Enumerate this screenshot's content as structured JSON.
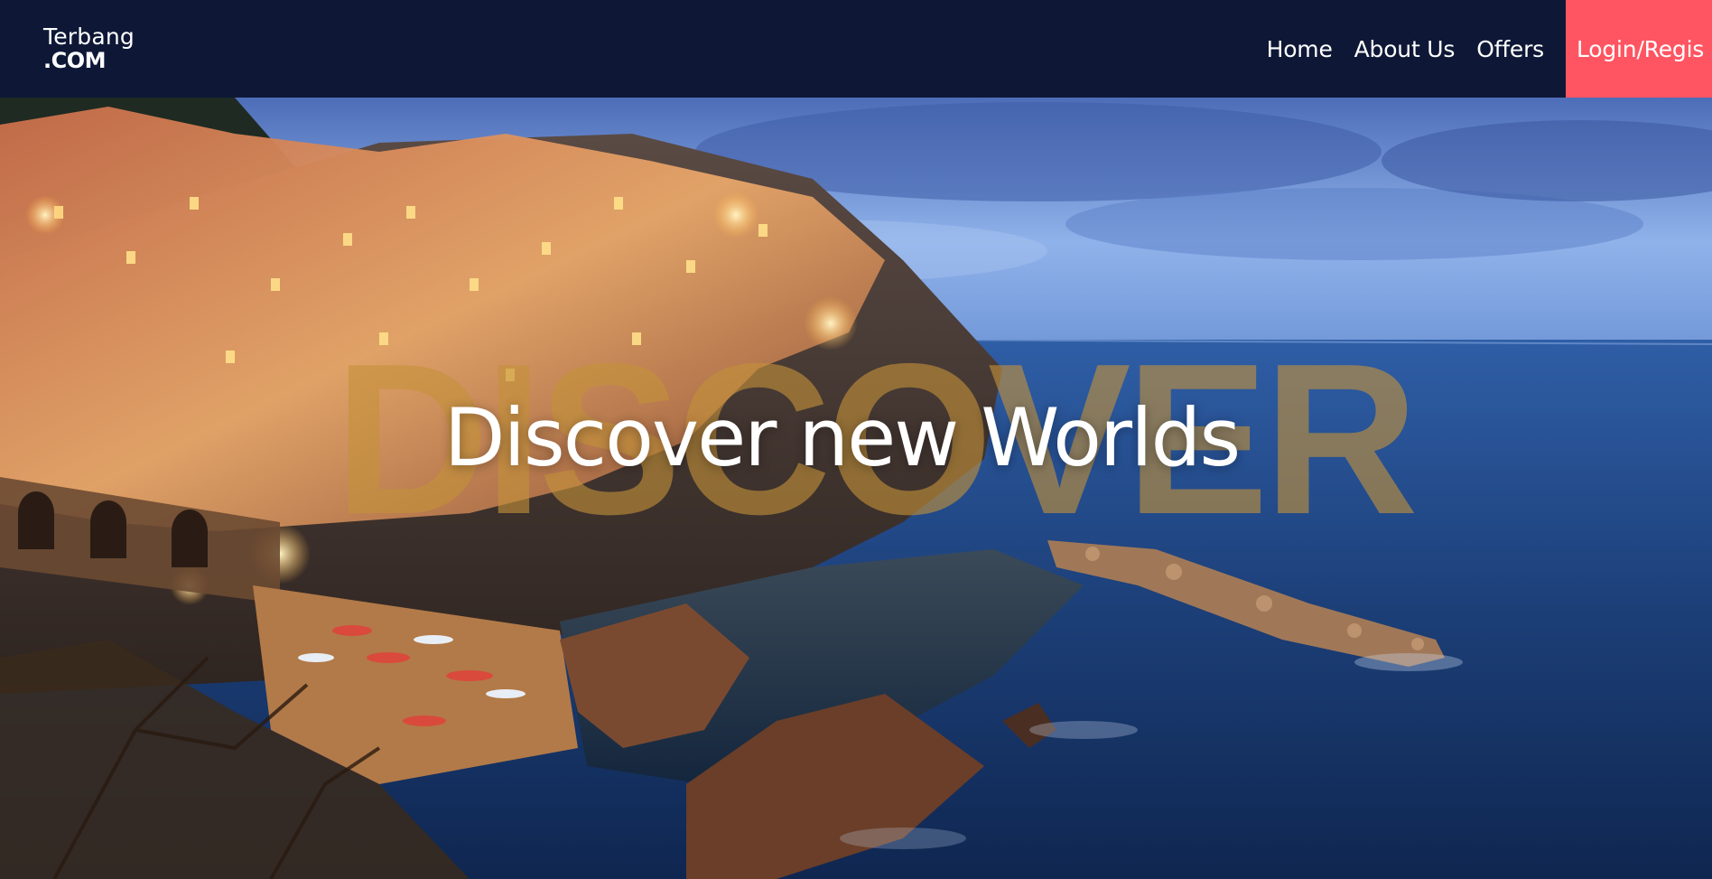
{
  "brand": {
    "line1": "Terbang",
    "line2": ".COM"
  },
  "nav": {
    "items": [
      {
        "label": "Home"
      },
      {
        "label": "About Us"
      },
      {
        "label": "Offers"
      }
    ],
    "login_label": "Login/Regis"
  },
  "hero": {
    "background_word": "DISCOVER",
    "headline": "Discover new Worlds",
    "image_icon": "coastal-village-photo"
  },
  "colors": {
    "navbar": "#0e1836",
    "login_accent": "#ff5562",
    "background_word": "#c4923a",
    "headline": "#ffffff"
  }
}
